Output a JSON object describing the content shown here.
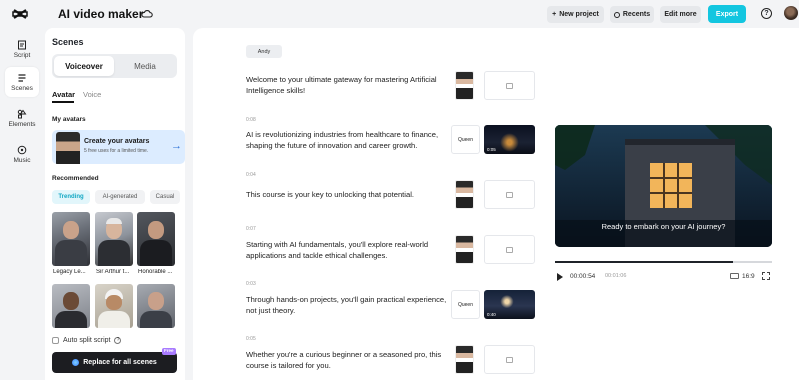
{
  "app": {
    "title": "AI video maker"
  },
  "toolbar": {
    "new_project": "New project",
    "recents": "Recents",
    "edit_more": "Edit more",
    "export": "Export",
    "help": "?"
  },
  "rail": [
    {
      "label": "Script",
      "icon": "script-icon"
    },
    {
      "label": "Scenes",
      "icon": "scenes-icon"
    },
    {
      "label": "Elements",
      "icon": "elements-icon"
    },
    {
      "label": "Music",
      "icon": "music-icon"
    }
  ],
  "panel": {
    "title": "Scenes",
    "tabs": [
      "Voiceover",
      "Media"
    ],
    "subtabs": [
      "Avatar",
      "Voice"
    ],
    "my_avatars": "My avatars",
    "create_title": "Create your avatars",
    "create_sub": "5 free uses for a limited time.",
    "recommended": "Recommended",
    "chips": [
      "Trending",
      "AI-generated",
      "Casual"
    ],
    "avatars": [
      {
        "name": "Legacy Le..."
      },
      {
        "name": "Sir Arthur t..."
      },
      {
        "name": "Honorable ..."
      },
      {
        "name": ""
      },
      {
        "name": ""
      },
      {
        "name": ""
      }
    ],
    "auto_split": "Auto split script",
    "replace_button": "Replace for all scenes",
    "free_tag": "Free"
  },
  "main": {
    "speaker": "Andy",
    "scenes": [
      {
        "time": "",
        "text": "Welcome to your ultimate gateway for mastering Artificial Intelligence skills!",
        "media": "empty"
      },
      {
        "time": "0:08",
        "text": "AI is revolutionizing industries from healthcare to finance, shaping the future of innovation and career growth.",
        "media": "clip",
        "clip_dur": "0:05",
        "voice": "Queen"
      },
      {
        "time": "0:04",
        "text": "This course is your key to unlocking that potential.",
        "media": "empty"
      },
      {
        "time": "0:07",
        "text": "Starting with AI fundamentals, you'll explore real-world applications and tackle ethical challenges.",
        "media": "empty"
      },
      {
        "time": "0:03",
        "text": "Through hands-on projects, you'll gain practical experience, not just theory.",
        "media": "clip",
        "clip_dur": "0:40",
        "voice": "Queen"
      },
      {
        "time": "0:05",
        "text": "Whether you're a curious beginner or a seasoned pro, this course is tailored for you.",
        "media": "empty"
      }
    ]
  },
  "preview": {
    "caption": "Ready to embark on your AI journey?",
    "current_time": "00:00:54",
    "total_time": "00:01:06",
    "progress": 0.82,
    "ratio": "16:9"
  },
  "colors": {
    "accent": "#13c6e0",
    "dark_button": "#1c1d21"
  }
}
